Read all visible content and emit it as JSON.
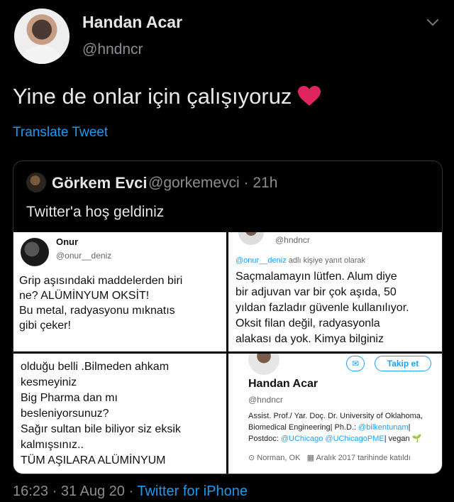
{
  "tweet": {
    "author_name": "Handan Acar",
    "author_handle": "@hndncr",
    "text": "Yine de onlar için çalışıyoruz",
    "translate_label": "Translate Tweet",
    "footer_time": "16:23",
    "footer_date": "31 Aug 20",
    "footer_source": "Twitter for iPhone",
    "heart_color": "#e0245e"
  },
  "quote": {
    "author_name": "Görkem Evci",
    "author_handle": "@gorkemevci",
    "time": "21h",
    "text": "Twitter'a hoş geldiniz",
    "panel1": {
      "name": "Onur",
      "handle": "@onur__deniz",
      "body": [
        "Grip aşısındaki maddelerden biri",
        "ne? ALÜMİNYUM OKSİT!",
        "Bu metal, radyasyonu mıknatıs",
        "gibi çeker!"
      ]
    },
    "panel2": {
      "handle": "@hndncr",
      "reply_user": "@onur__deniz",
      "reply_suffix": "adlı kişiye yanıt olarak",
      "body": [
        "Saçmalamayın lütfen. Alum diye",
        "bir adjuvan var bir çok aşıda, 50",
        "yıldan fazladır güvenle kullanılıyor.",
        "Oksit filan değil, radyasyonla",
        "alakası da yok. Kimya bilginiz"
      ]
    },
    "panel3": {
      "body": [
        "olduğu belli .Bilmeden ahkam",
        "kesmeyiniz",
        "Big Pharma dan mı",
        "besleniyorsunuz?",
        "Sağır sultan bile biliyor siz eksik",
        "kalmışsınız..",
        "TÜM AŞILARA ALÜMİNYUM"
      ]
    },
    "panel4": {
      "follow_label": "Takip et",
      "name": "Handan Acar",
      "handle": "@hndncr",
      "bio_line1": "Assist. Prof./ Yar. Doç. Dr. University of Oklahoma,",
      "bio_line2_prefix": "Biomedical Engineering| Ph.D.:",
      "bio_line2_link": "@bilkentunam",
      "bio_line2_suffix": "|",
      "bio_line3_prefix": "Postdoc:",
      "bio_line3_link1": "@UChicago",
      "bio_line3_link2": "@UChicagoPME",
      "bio_line3_suffix": "| vegan",
      "location": "Norman, OK",
      "joined": "Aralık 2017 tarihinde katıldı"
    }
  }
}
